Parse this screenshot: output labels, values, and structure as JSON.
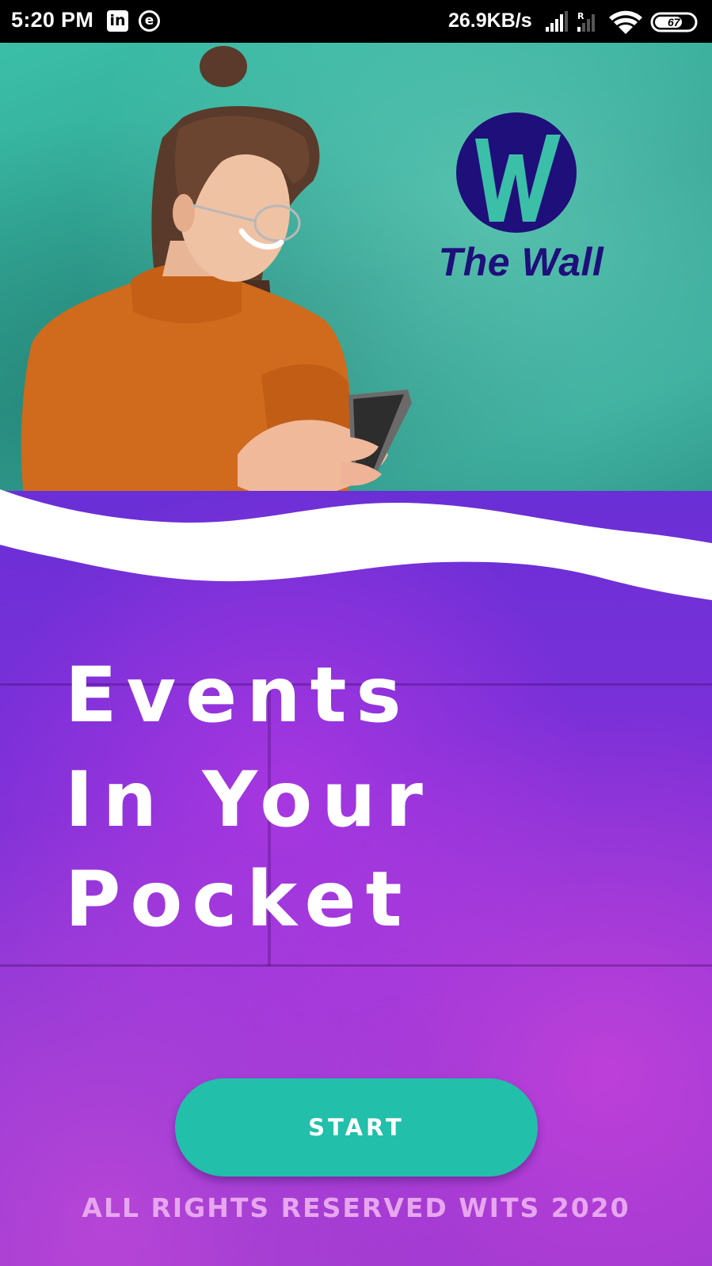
{
  "status_bar": {
    "time": "5:20 PM",
    "app_icons": [
      "linkedin-icon",
      "edge-icon"
    ],
    "linkedin_glyph": "in",
    "edge_glyph": "e",
    "network_speed": "26.9KB/s",
    "battery_level": "67"
  },
  "brand": {
    "name": "The Wall",
    "logo_color": "#1e0f7a"
  },
  "hero": {
    "tagline_lines": [
      "Events",
      "In Your",
      "Pocket"
    ]
  },
  "actions": {
    "start_label": "START",
    "button_color": "#22bfaa"
  },
  "footer": {
    "copyright": "ALL RIGHTS RESERVED WITS 2020"
  }
}
